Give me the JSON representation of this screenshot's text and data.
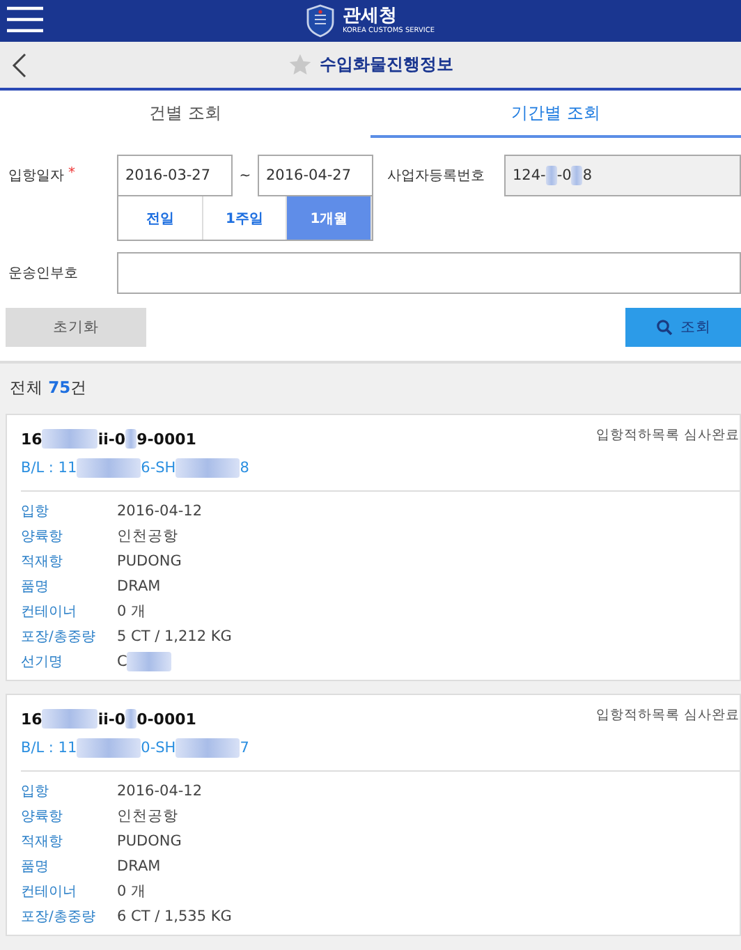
{
  "header": {
    "title": "관세청",
    "subtitle": "KOREA CUSTOMS SERVICE"
  },
  "page_title": {
    "text": "수입화물진행정보",
    "favorite": false
  },
  "tabs": [
    {
      "label": "건별 조회",
      "selected": false
    },
    {
      "label": "기간별 조회",
      "selected": true
    }
  ],
  "form": {
    "date_label": "입항일자",
    "required_mark": "*",
    "date_from": "2016-03-27",
    "separator": "~",
    "date_to": "2016-04-27",
    "quick_ranges": [
      {
        "label": "전일",
        "selected": false
      },
      {
        "label": "1주일",
        "selected": false
      },
      {
        "label": "1개월",
        "selected": true
      }
    ],
    "business_no_label": "사업자등록번호",
    "business_no": [
      {
        "kind": "text",
        "text": "124-"
      },
      {
        "kind": "redacted"
      },
      {
        "kind": "text",
        "text": "-0"
      },
      {
        "kind": "redacted"
      },
      {
        "kind": "text",
        "text": "8"
      }
    ],
    "carrier_label": "운송인부호",
    "reset_button": "초기화",
    "search_button": "조회"
  },
  "summary": "전체 **75**건",
  "cards": [
    {
      "id": [
        {
          "kind": "text",
          "text": "16"
        },
        {
          "kind": "redacted"
        },
        {
          "kind": "text",
          "text": "ii-0"
        },
        {
          "kind": "redacted"
        },
        {
          "kind": "text",
          "text": "9-0001"
        }
      ],
      "status": "입항적하목록 심사완료",
      "bl": [
        {
          "kind": "text",
          "text": "B/L : 11"
        },
        {
          "kind": "redacted"
        },
        {
          "kind": "text",
          "text": "6-SH"
        },
        {
          "kind": "redacted"
        },
        {
          "kind": "text",
          "text": "8"
        }
      ],
      "fields": [
        {
          "label": "입항",
          "value": [
            {
              "kind": "text",
              "text": "2016-04-12"
            }
          ]
        },
        {
          "label": "양륙항",
          "value": [
            {
              "kind": "text",
              "text": "인천공항"
            }
          ]
        },
        {
          "label": "적재항",
          "value": [
            {
              "kind": "text",
              "text": "PUDONG"
            }
          ]
        },
        {
          "label": "품명",
          "value": [
            {
              "kind": "text",
              "text": "DRAM"
            }
          ]
        },
        {
          "label": "컨테이너",
          "value": [
            {
              "kind": "text",
              "text": "0 개"
            }
          ]
        },
        {
          "label": "포장/총중량",
          "value": [
            {
              "kind": "text",
              "text": "5 CT / 1,212 KG"
            }
          ]
        },
        {
          "label": "선기명",
          "value": [
            {
              "kind": "text",
              "text": "C"
            },
            {
              "kind": "redacted"
            }
          ]
        }
      ]
    },
    {
      "id": [
        {
          "kind": "text",
          "text": "16"
        },
        {
          "kind": "redacted"
        },
        {
          "kind": "text",
          "text": "ii-0"
        },
        {
          "kind": "redacted"
        },
        {
          "kind": "text",
          "text": "0-0001"
        }
      ],
      "status": "입항적하목록 심사완료",
      "bl": [
        {
          "kind": "text",
          "text": "B/L : 11"
        },
        {
          "kind": "redacted"
        },
        {
          "kind": "text",
          "text": "0-SH"
        },
        {
          "kind": "redacted"
        },
        {
          "kind": "text",
          "text": "7"
        }
      ],
      "fields": [
        {
          "label": "입항",
          "value": [
            {
              "kind": "text",
              "text": "2016-04-12"
            }
          ]
        },
        {
          "label": "양륙항",
          "value": [
            {
              "kind": "text",
              "text": "인천공항"
            }
          ]
        },
        {
          "label": "적재항",
          "value": [
            {
              "kind": "text",
              "text": "PUDONG"
            }
          ]
        },
        {
          "label": "품명",
          "value": [
            {
              "kind": "text",
              "text": "DRAM"
            }
          ]
        },
        {
          "label": "컨테이너",
          "value": [
            {
              "kind": "text",
              "text": "0 개"
            }
          ]
        },
        {
          "label": "포장/총중량",
          "value": [
            {
              "kind": "text",
              "text": "6 CT / 1,535 KG"
            }
          ]
        }
      ]
    }
  ]
}
